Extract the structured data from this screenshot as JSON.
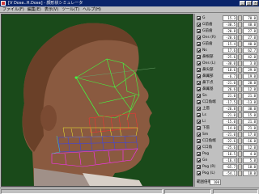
{
  "window": {
    "title": "[V Dose..H.Dose] - 顔形状シミュレータ",
    "minimize": "_",
    "maximize": "□",
    "close": "×"
  },
  "menu": [
    "ファイル(F)",
    "編集(E)",
    "表示(V)",
    "ツール(T)",
    "ヘルプ(H)"
  ],
  "params": [
    {
      "label": "G",
      "v1": "15.3",
      "v2": "70.0",
      "checked": true
    },
    {
      "label": "G前歯",
      "v1": "-30.5",
      "v2": "48.0",
      "checked": true
    },
    {
      "label": "G前歯",
      "v1": "-20.8",
      "v2": "27.0",
      "checked": true
    },
    {
      "label": "Ons (R)",
      "v1": "-20.6",
      "v2": "27.0",
      "checked": true
    },
    {
      "label": "G前歯",
      "v1": "-15.4",
      "v2": "40.0",
      "checked": true
    },
    {
      "label": "Ns",
      "v1": "17.6",
      "v2": "62.7",
      "checked": true
    },
    {
      "label": "鼻根部",
      "v1": "-25.6",
      "v2": "42.0",
      "checked": true
    },
    {
      "label": "Ons (L)",
      "v1": "-30.0",
      "v2": "3.0",
      "checked": true
    },
    {
      "label": "鼻尖部",
      "v1": "-18.6",
      "v2": "29.0",
      "checked": true
    },
    {
      "label": "鼻翼部",
      "v1": "-6.7",
      "v2": "19.0",
      "checked": true
    },
    {
      "label": "鼻下点",
      "v1": "-21.0",
      "v2": "20.0",
      "checked": true
    },
    {
      "label": "鼻翼基",
      "v1": "26.6",
      "v2": "12.0",
      "checked": true
    },
    {
      "label": "Sn",
      "v1": "21.0",
      "v2": "21.0",
      "checked": true
    },
    {
      "label": "C口角端",
      "v1": "-17.5",
      "v2": "-13.0",
      "checked": true
    },
    {
      "label": "上唇",
      "v1": "-26.8",
      "v2": "30.0",
      "checked": true
    },
    {
      "label": "Ls",
      "v1": "-21.0",
      "v2": "15.0",
      "checked": true
    },
    {
      "label": "Li",
      "v1": "-15.0",
      "v2": "21.0",
      "checked": true
    },
    {
      "label": "下唇",
      "v1": "-14.0",
      "v2": "21.0",
      "checked": true
    },
    {
      "label": "Sm",
      "v1": "-21.0",
      "v2": "17.0",
      "checked": true
    },
    {
      "label": "C口角端",
      "v1": "-22.6",
      "v2": "-16.0",
      "checked": true
    },
    {
      "label": "C口角",
      "v1": "-25.6",
      "v2": "12.0",
      "checked": true
    },
    {
      "label": "Pog",
      "v1": "-16.5",
      "v2": "4.0",
      "checked": true
    },
    {
      "label": "Gn",
      "v1": "-16.4",
      "v2": "5.0",
      "checked": true
    },
    {
      "label": "Pog (R)",
      "v1": "-65.7",
      "v2": "18.0",
      "checked": true
    },
    {
      "label": "Pog (L)",
      "v1": "-54.1",
      "v2": "18.0",
      "checked": true
    }
  ],
  "bottom": {
    "label": "範囲倍率",
    "value": "100"
  },
  "colors": {
    "background": "#1a4a1a",
    "skin": "#8a5a40",
    "mesh_green": "#40ff40",
    "mesh_red": "#ff3030",
    "mesh_yellow": "#f0f030",
    "mesh_blue": "#3040ff",
    "mesh_magenta": "#ff30ff"
  }
}
